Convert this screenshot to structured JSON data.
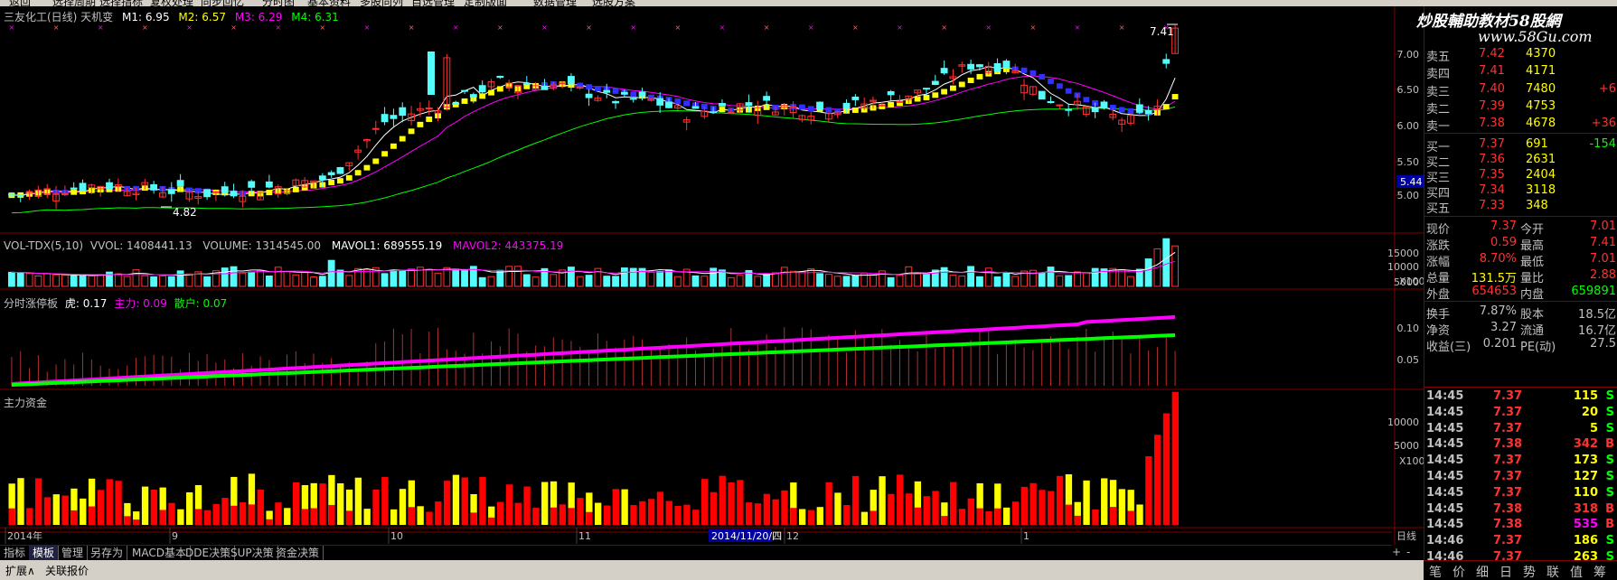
{
  "menu": [
    "返回",
    "选择周期",
    "选择指标",
    "复权处理",
    "同步回忆",
    "分时图",
    "基本资料",
    "多股同列",
    "自选管理",
    "定制版面",
    "数据管理",
    "选股方案"
  ],
  "main_panel": {
    "title": "三友化工(日线) 天机变",
    "m1": "M1: 6.95",
    "m2": "M2: 6.57",
    "m3": "M3: 6.29",
    "m4": "M4: 6.31",
    "high_label": "7.41",
    "low_label": "4.82",
    "axis_ticks": [
      "7.00",
      "6.50",
      "6.00",
      "5.50",
      "5.00"
    ],
    "cursor_price": "5.44"
  },
  "vol_panel": {
    "title": "VOL-TDX(5,10)",
    "vvol": "VVOL: 1408441.13",
    "volume": "VOLUME: 1314545.00",
    "mavol1": "MAVOL1: 689555.19",
    "mavol2": "MAVOL2: 443375.19",
    "axis_ticks": [
      "15000",
      "10000",
      "5000"
    ],
    "unit": "X100"
  },
  "zt_panel": {
    "title": "分时涨停板",
    "hu": "虎: 0.17",
    "zl": "主力: 0.09",
    "sh": "散户: 0.07",
    "axis_ticks": [
      "0.10",
      "0.05"
    ]
  },
  "zj_panel": {
    "title": "主力资金",
    "axis_ticks": [
      "10000",
      "5000"
    ],
    "unit": "X100"
  },
  "time_axis": {
    "labels": [
      "2014年",
      "9",
      "10",
      "11",
      "12",
      "1"
    ],
    "cursor_date": "2014/11/20/四",
    "period": "日线"
  },
  "tabs": [
    "指标",
    "模板",
    "管理",
    "另存为",
    "MACD基本",
    "DDE决策",
    "SUP决策",
    "资金决策"
  ],
  "bottom": {
    "expand": "扩展∧",
    "related": "关联报价",
    "nav_plus": "+",
    "nav_minus": "-"
  },
  "watermark": {
    "line1": "炒股輔助教材58股網",
    "line2": "www.58Gu.com"
  },
  "order_book": {
    "asks": [
      {
        "label": "卖五",
        "price": "7.42",
        "vol": "4370",
        "chg": ""
      },
      {
        "label": "卖四",
        "price": "7.41",
        "vol": "4171",
        "chg": ""
      },
      {
        "label": "卖三",
        "price": "7.40",
        "vol": "7480",
        "chg": "+6"
      },
      {
        "label": "卖二",
        "price": "7.39",
        "vol": "4753",
        "chg": ""
      },
      {
        "label": "卖一",
        "price": "7.38",
        "vol": "4678",
        "chg": "+36"
      }
    ],
    "bids": [
      {
        "label": "买一",
        "price": "7.37",
        "vol": "691",
        "chg": "-154"
      },
      {
        "label": "买二",
        "price": "7.36",
        "vol": "2631",
        "chg": ""
      },
      {
        "label": "买三",
        "price": "7.35",
        "vol": "2404",
        "chg": ""
      },
      {
        "label": "买四",
        "price": "7.34",
        "vol": "3118",
        "chg": ""
      },
      {
        "label": "买五",
        "price": "7.33",
        "vol": "348",
        "chg": ""
      }
    ]
  },
  "quote": {
    "rows": [
      {
        "l1": "现价",
        "v1": "7.37",
        "l2": "今开",
        "v2": "7.01"
      },
      {
        "l1": "涨跌",
        "v1": "0.59",
        "l2": "最高",
        "v2": "7.41"
      },
      {
        "l1": "涨幅",
        "v1": "8.70%",
        "l2": "最低",
        "v2": "7.01"
      },
      {
        "l1": "总量",
        "v1": "131.5万",
        "l2": "量比",
        "v2": "2.88"
      },
      {
        "l1": "外盘",
        "v1": "654653",
        "l2": "内盘",
        "v2": "659891"
      },
      {
        "l1": "换手",
        "v1": "7.87%",
        "l2": "股本",
        "v2": "18.5亿"
      },
      {
        "l1": "净资",
        "v1": "3.27",
        "l2": "流通",
        "v2": "16.7亿"
      },
      {
        "l1": "收益(三)",
        "v1": "0.201",
        "l2": "PE(动)",
        "v2": "27.5"
      }
    ]
  },
  "ticks": [
    {
      "time": "14:45",
      "price": "7.37",
      "vol": "115",
      "side": "S"
    },
    {
      "time": "14:45",
      "price": "7.37",
      "vol": "20",
      "side": "S"
    },
    {
      "time": "14:45",
      "price": "7.37",
      "vol": "5",
      "side": "S"
    },
    {
      "time": "14:45",
      "price": "7.38",
      "vol": "342",
      "side": "B"
    },
    {
      "time": "14:45",
      "price": "7.37",
      "vol": "173",
      "side": "S"
    },
    {
      "time": "14:45",
      "price": "7.37",
      "vol": "127",
      "side": "S"
    },
    {
      "time": "14:45",
      "price": "7.37",
      "vol": "110",
      "side": "S"
    },
    {
      "time": "14:45",
      "price": "7.38",
      "vol": "318",
      "side": "B"
    },
    {
      "time": "14:45",
      "price": "7.38",
      "vol": "535",
      "side": "B"
    },
    {
      "time": "14:46",
      "price": "7.37",
      "vol": "186",
      "side": "S"
    },
    {
      "time": "14:46",
      "price": "7.37",
      "vol": "263",
      "side": "S"
    }
  ],
  "right_tabs": [
    "笔",
    "价",
    "细",
    "日",
    "势",
    "联",
    "值",
    "筹"
  ],
  "colors": {
    "up": "#ff3232",
    "down": "#54fcfc",
    "ma_white": "#ffffff",
    "ma_yellow": "#ffff00",
    "ma_magenta": "#ff00ff",
    "ma_green": "#00ff00",
    "border": "#800000",
    "zj_red": "#ff0000",
    "zj_yellow": "#ffff00"
  }
}
